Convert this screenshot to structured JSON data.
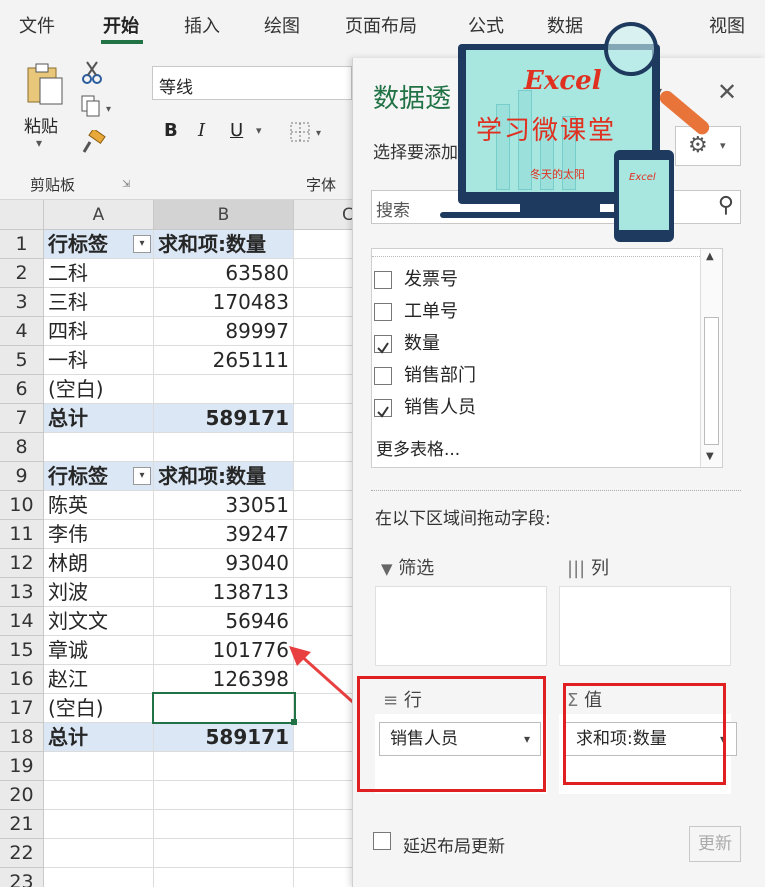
{
  "tabs": [
    "文件",
    "开始",
    "插入",
    "绘图",
    "页面布局",
    "公式",
    "数据",
    "视图"
  ],
  "ribbon": {
    "paste_label": "粘贴",
    "font_name": "等线",
    "bold": "B",
    "italic": "I",
    "underline": "U",
    "clipboard_group": "剪贴板",
    "font_group": "字体"
  },
  "logo": {
    "title": "Excel",
    "subtitle": "学习微课堂",
    "author": "冬天的太阳",
    "phone_title": "Excel"
  },
  "columns": [
    "A",
    "B",
    "C"
  ],
  "rows": [
    {
      "num": "1",
      "a": "行标签",
      "b": "求和项:数量",
      "type": "header"
    },
    {
      "num": "2",
      "a": "二科",
      "b": "63580"
    },
    {
      "num": "3",
      "a": "三科",
      "b": "170483"
    },
    {
      "num": "4",
      "a": "四科",
      "b": "89997"
    },
    {
      "num": "5",
      "a": "一科",
      "b": "265111"
    },
    {
      "num": "6",
      "a": "(空白)",
      "b": ""
    },
    {
      "num": "7",
      "a": "总计",
      "b": "589171",
      "type": "total"
    },
    {
      "num": "8",
      "a": "",
      "b": ""
    },
    {
      "num": "9",
      "a": "行标签",
      "b": "求和项:数量",
      "type": "header"
    },
    {
      "num": "10",
      "a": "陈英",
      "b": "33051"
    },
    {
      "num": "11",
      "a": "李伟",
      "b": "39247"
    },
    {
      "num": "12",
      "a": "林朗",
      "b": "93040"
    },
    {
      "num": "13",
      "a": "刘波",
      "b": "138713"
    },
    {
      "num": "14",
      "a": "刘文文",
      "b": "56946"
    },
    {
      "num": "15",
      "a": "章诚",
      "b": "101776"
    },
    {
      "num": "16",
      "a": "赵江",
      "b": "126398"
    },
    {
      "num": "17",
      "a": "(空白)",
      "b": ""
    },
    {
      "num": "18",
      "a": "总计",
      "b": "589171",
      "type": "total"
    },
    {
      "num": "19",
      "a": "",
      "b": ""
    },
    {
      "num": "20",
      "a": "",
      "b": ""
    },
    {
      "num": "21",
      "a": "",
      "b": ""
    },
    {
      "num": "22",
      "a": "",
      "b": ""
    },
    {
      "num": "23",
      "a": "",
      "b": ""
    }
  ],
  "pane": {
    "title": "数据透",
    "choose_fields": "选择要添加",
    "search_placeholder": "搜索",
    "fields": [
      {
        "label": "发票号",
        "checked": false
      },
      {
        "label": "工单号",
        "checked": false
      },
      {
        "label": "数量",
        "checked": true
      },
      {
        "label": "销售部门",
        "checked": false
      },
      {
        "label": "销售人员",
        "checked": true
      }
    ],
    "more_tables": "更多表格...",
    "drag_hint": "在以下区域间拖动字段:",
    "filter_label": "筛选",
    "columns_label": "列",
    "rows_label": "行",
    "values_label": "值",
    "rows_value": "销售人员",
    "values_value": "求和项:数量",
    "defer_label": "延迟布局更新",
    "update_button": "更新"
  }
}
